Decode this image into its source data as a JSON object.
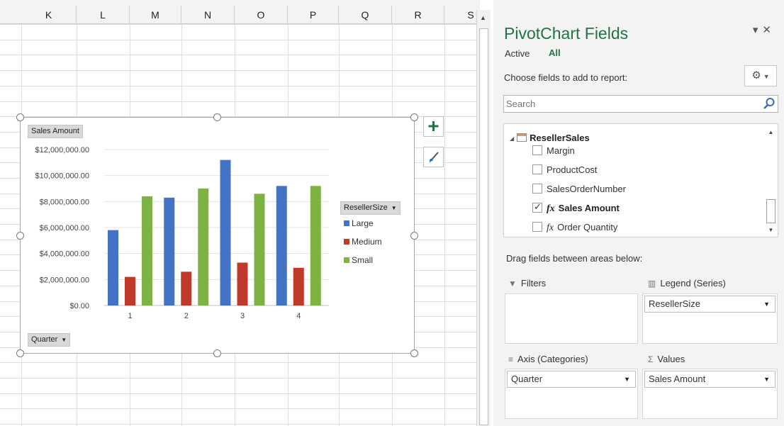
{
  "sheet": {
    "columns": [
      "K",
      "L",
      "M",
      "N",
      "O",
      "P",
      "Q",
      "R",
      "S"
    ]
  },
  "chart": {
    "value_field_button": "Sales Amount",
    "axis_field_button": "Quarter",
    "legend_field_button": "ResellerSize",
    "add_element_icon": "plus-icon",
    "style_icon": "paintbrush-icon"
  },
  "chart_data": {
    "type": "bar",
    "categories": [
      "1",
      "2",
      "3",
      "4"
    ],
    "series": [
      {
        "name": "Large",
        "color": "#4472c4",
        "values": [
          5800000,
          8300000,
          11200000,
          9200000
        ]
      },
      {
        "name": "Medium",
        "color": "#c0392b",
        "values": [
          2200000,
          2600000,
          3300000,
          2900000
        ]
      },
      {
        "name": "Small",
        "color": "#7cb342",
        "values": [
          8400000,
          9000000,
          8600000,
          9200000
        ]
      }
    ],
    "y_ticks": [
      "$0.00",
      "$2,000,000.00",
      "$4,000,000.00",
      "$6,000,000.00",
      "$8,000,000.00",
      "$10,000,000.00",
      "$12,000,000.00"
    ],
    "ylim": [
      0,
      12000000
    ],
    "grid": true,
    "legend_position": "right"
  },
  "pane": {
    "title": "PivotChart Fields",
    "tabs": {
      "active": "Active",
      "all": "All"
    },
    "choose_label": "Choose fields to add to report:",
    "search": {
      "placeholder": "Search",
      "value": ""
    },
    "table_name": "ResellerSales",
    "fields": [
      {
        "label": "Margin",
        "checked": false,
        "measure": false
      },
      {
        "label": "ProductCost",
        "checked": false,
        "measure": false
      },
      {
        "label": "SalesOrderNumber",
        "checked": false,
        "measure": false
      },
      {
        "label": "Sales Amount",
        "checked": true,
        "measure": true
      },
      {
        "label": "Order Quantity",
        "checked": false,
        "measure": true
      }
    ],
    "drag_label": "Drag fields between areas below:",
    "areas": {
      "filters": {
        "label": "Filters",
        "items": []
      },
      "legend": {
        "label": "Legend (Series)",
        "items": [
          "ResellerSize"
        ]
      },
      "axis": {
        "label": "Axis (Categories)",
        "items": [
          "Quarter"
        ]
      },
      "values": {
        "label": "Values",
        "items": [
          "Sales Amount"
        ]
      }
    },
    "accent_color": "#217346"
  }
}
